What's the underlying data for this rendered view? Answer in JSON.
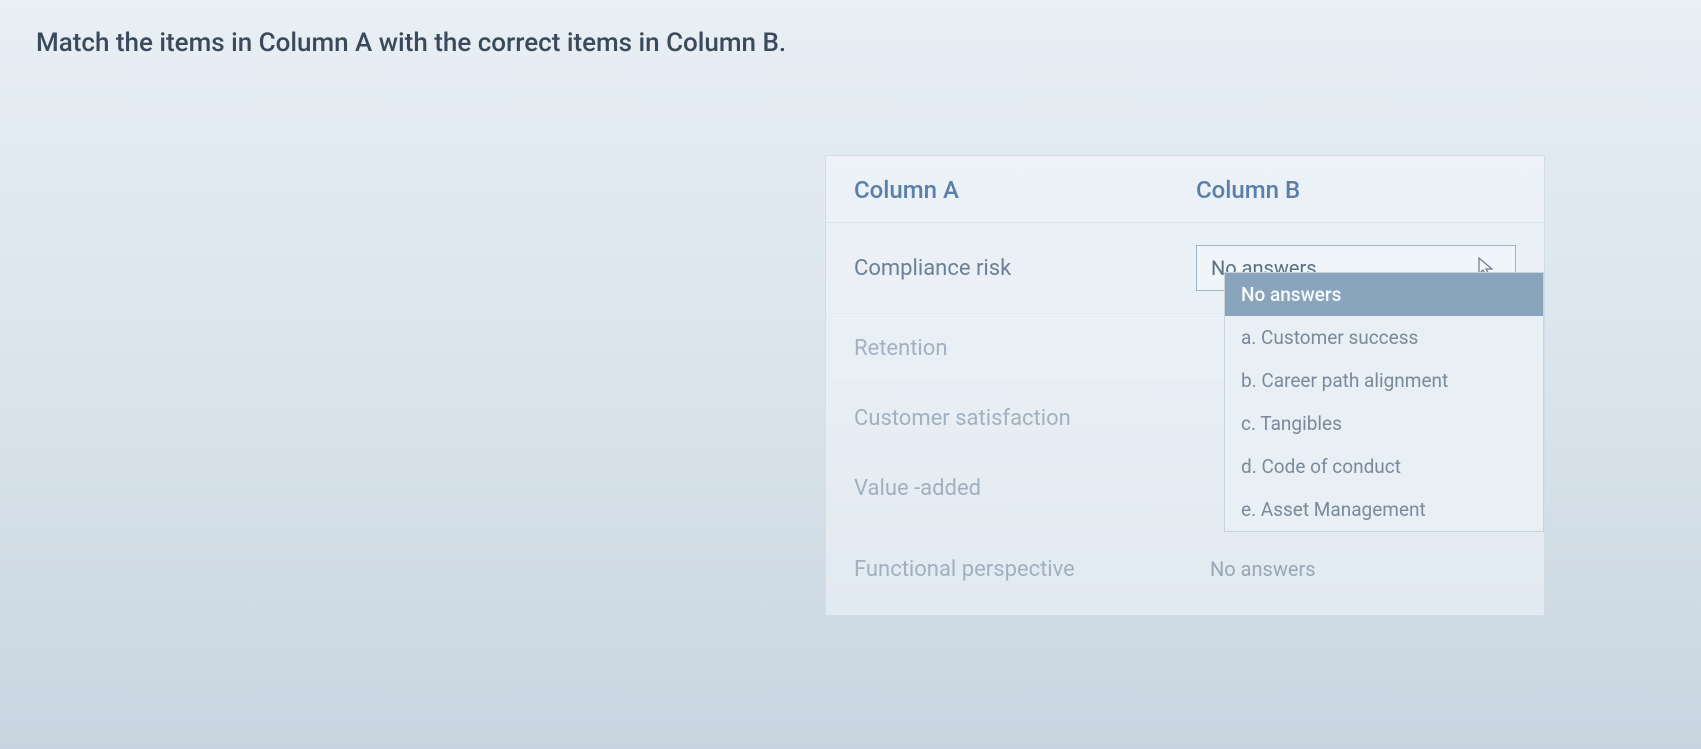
{
  "question": "Match the items in Column A with the correct items in Column B.",
  "headers": {
    "colA": "Column A",
    "colB": "Column B"
  },
  "rows": [
    {
      "label": "Compliance risk",
      "value": "No answers"
    },
    {
      "label": "Retention",
      "value": ""
    },
    {
      "label": "Customer satisfaction",
      "value": ""
    },
    {
      "label": "Value -added",
      "value": ""
    },
    {
      "label": "Functional perspective",
      "value": "No answers"
    }
  ],
  "dropdown": {
    "options": [
      "No answers",
      "a. Customer success",
      "b. Career path alignment",
      "c. Tangibles",
      "d. Code of conduct",
      "e. Asset Management"
    ]
  }
}
